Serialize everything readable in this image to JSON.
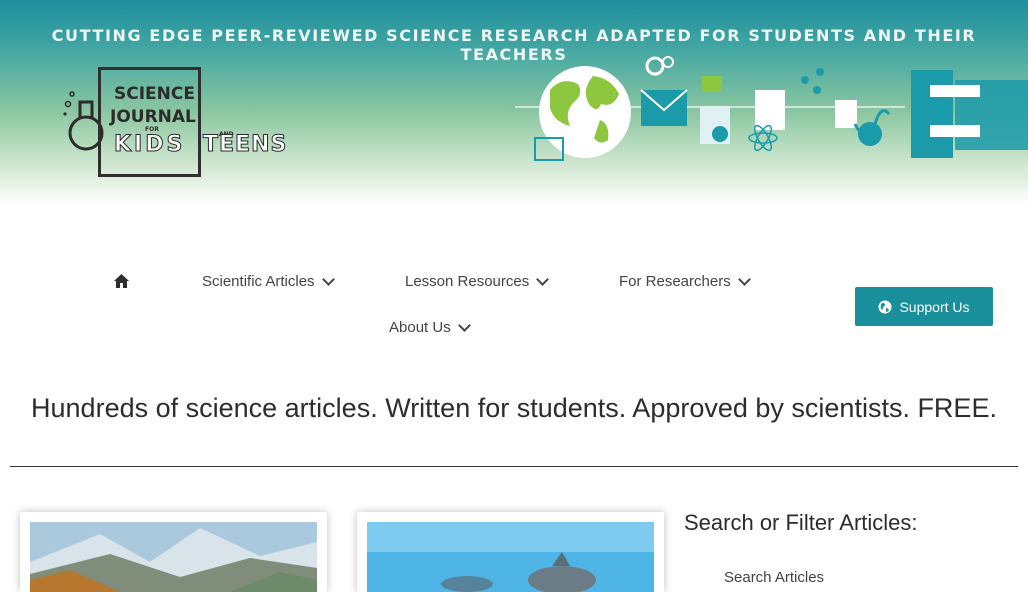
{
  "banner": {
    "tagline": "CUTTING EDGE PEER-REVIEWED SCIENCE RESEARCH ADAPTED FOR STUDENTS AND THEIR TEACHERS"
  },
  "logo": {
    "line1": "SCIENCE",
    "line2": "JOURNAL",
    "for": "FOR",
    "kids": "KIDS",
    "and": "AND",
    "teens": "TEENS"
  },
  "nav": {
    "home_icon": "home-icon",
    "items": [
      {
        "label": "Scientific Articles"
      },
      {
        "label": "Lesson Resources"
      },
      {
        "label": "For Researchers"
      },
      {
        "label": "About Us"
      }
    ]
  },
  "support_button": {
    "label": "Support Us",
    "icon": "globe-icon"
  },
  "headline": "Hundreds of science articles. Written for students. Approved by scientists. FREE.",
  "sidebar": {
    "title": "Search or Filter Articles:",
    "search_label": "Search Articles"
  },
  "colors": {
    "accent": "#1a8f9c",
    "banner_top": "#1e8e9c",
    "banner_mid": "#8cc7a1"
  }
}
